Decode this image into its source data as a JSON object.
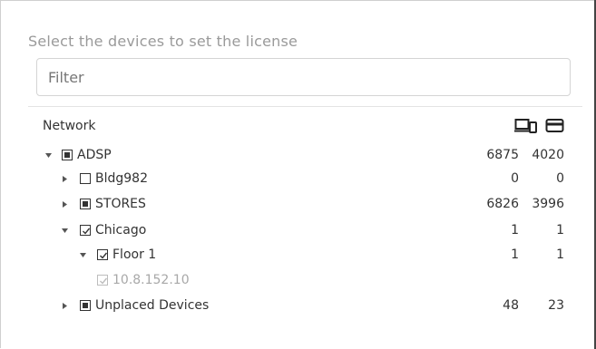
{
  "dialog": {
    "title": "Select the devices to set the license",
    "filter_placeholder": "Filter"
  },
  "table": {
    "header_label": "Network",
    "column_icons": [
      "devices-icon",
      "license-card-icon"
    ]
  },
  "tree": [
    {
      "label": "ADSP",
      "level": 0,
      "expand": "expanded",
      "check": "partial",
      "v1": "6875",
      "v2": "4020"
    },
    {
      "label": "Bldg982",
      "level": 1,
      "expand": "collapsed",
      "check": "unchecked",
      "v1": "0",
      "v2": "0"
    },
    {
      "label": "STORES",
      "level": 1,
      "expand": "collapsed",
      "check": "partial",
      "v1": "6826",
      "v2": "3996"
    },
    {
      "label": "Chicago",
      "level": 1,
      "expand": "expanded",
      "check": "checked",
      "v1": "1",
      "v2": "1"
    },
    {
      "label": "Floor 1",
      "level": 2,
      "expand": "expanded",
      "check": "checked",
      "v1": "1",
      "v2": "1"
    },
    {
      "label": "10.8.152.10",
      "level": 3,
      "expand": "none",
      "check": "checked-disabled",
      "v1": "",
      "v2": ""
    },
    {
      "label": "Unplaced Devices",
      "level": 1,
      "expand": "collapsed",
      "check": "partial",
      "v1": "48",
      "v2": "23"
    }
  ]
}
